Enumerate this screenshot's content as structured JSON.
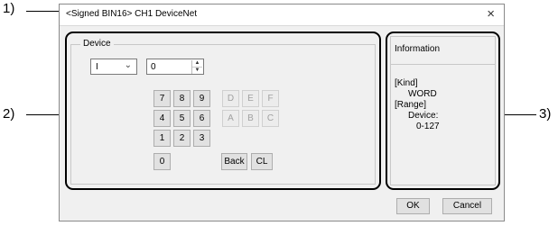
{
  "callouts": {
    "c1": "1)",
    "c2": "2)",
    "c3": "3)"
  },
  "dialog": {
    "title": "<Signed BIN16> CH1 DeviceNet",
    "close_glyph": "×"
  },
  "device": {
    "group_label": "Device",
    "device_type": "I",
    "value": "0",
    "keypad": {
      "row1": [
        "7",
        "8",
        "9"
      ],
      "row2": [
        "4",
        "5",
        "6"
      ],
      "row3": [
        "1",
        "2",
        "3"
      ],
      "zero": "0",
      "hex_row1": [
        "D",
        "E",
        "F"
      ],
      "hex_row2": [
        "A",
        "B",
        "C"
      ],
      "back": "Back",
      "clear": "CL"
    }
  },
  "information": {
    "title": "Information",
    "kind_label": "[Kind]",
    "kind_value": "WORD",
    "range_label": "[Range]",
    "range_device_label": "Device:",
    "range_value": "0-127"
  },
  "buttons": {
    "ok": "OK",
    "cancel": "Cancel"
  }
}
